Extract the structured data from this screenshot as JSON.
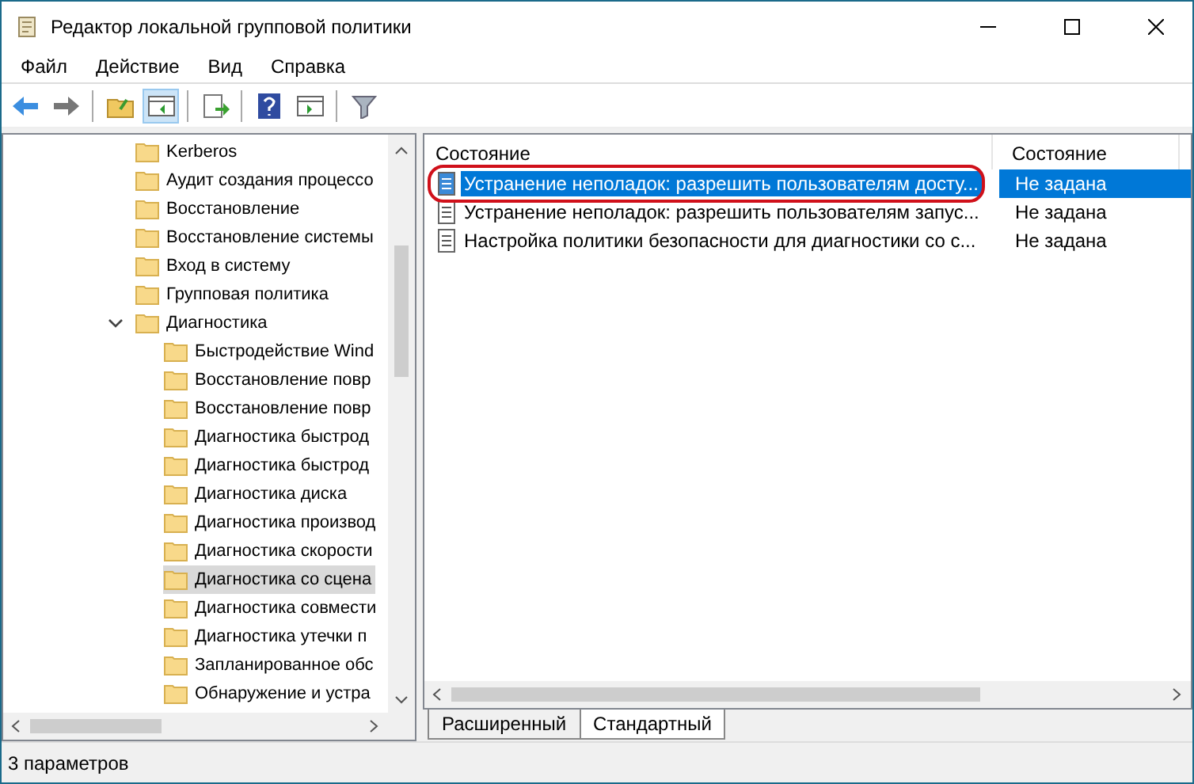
{
  "window": {
    "title": "Редактор локальной групповой политики"
  },
  "menu": [
    "Файл",
    "Действие",
    "Вид",
    "Справка"
  ],
  "tree": [
    {
      "label": "Kerberos",
      "selected": false
    },
    {
      "label": "Аудит создания процессо",
      "selected": false
    },
    {
      "label": "Восстановление",
      "selected": false
    },
    {
      "label": "Восстановление системы",
      "selected": false
    },
    {
      "label": "Вход в систему",
      "selected": false
    },
    {
      "label": "Групповая политика",
      "selected": false
    },
    {
      "label": "Диагностика",
      "selected": false,
      "expanded": true,
      "children": [
        {
          "label": "Быстродействие Wind",
          "selected": false
        },
        {
          "label": "Восстановление повр",
          "selected": false
        },
        {
          "label": "Восстановление повр",
          "selected": false
        },
        {
          "label": "Диагностика быстрод",
          "selected": false
        },
        {
          "label": "Диагностика быстрод",
          "selected": false
        },
        {
          "label": "Диагностика диска",
          "selected": false
        },
        {
          "label": "Диагностика производ",
          "selected": false
        },
        {
          "label": "Диагностика скорости",
          "selected": false
        },
        {
          "label": "Диагностика со сцена",
          "selected": true
        },
        {
          "label": "Диагностика совмести",
          "selected": false
        },
        {
          "label": "Диагностика утечки п",
          "selected": false
        },
        {
          "label": "Запланированное обс",
          "selected": false
        },
        {
          "label": "Обнаружение и устра",
          "selected": false
        }
      ]
    }
  ],
  "table": {
    "columns": [
      "Состояние",
      "Состояние"
    ],
    "rows": [
      {
        "name": "Устранение неполадок: разрешить пользователям досту...",
        "state": "Не задана",
        "selected": true,
        "circled": true
      },
      {
        "name": "Устранение неполадок: разрешить пользователям запус...",
        "state": "Не задана",
        "selected": false,
        "circled": false
      },
      {
        "name": "Настройка политики безопасности для диагностики со с...",
        "state": "Не задана",
        "selected": false,
        "circled": false
      }
    ]
  },
  "tabs": [
    {
      "label": "Расширенный",
      "selected": false
    },
    {
      "label": "Стандартный",
      "selected": true
    }
  ],
  "status_bar": "3 параметров"
}
